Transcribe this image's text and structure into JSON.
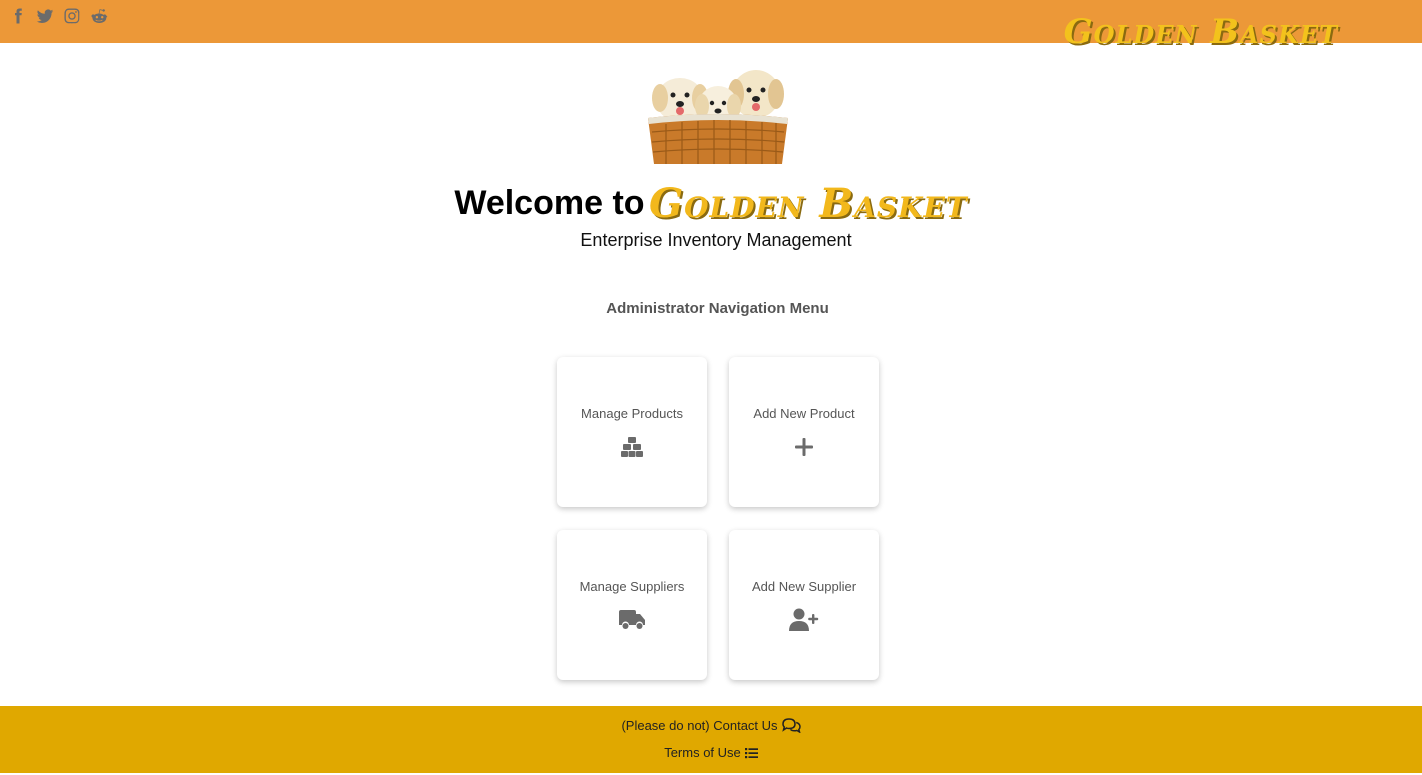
{
  "header": {
    "brand": "Golden Basket",
    "social": [
      {
        "icon": "facebook-icon"
      },
      {
        "icon": "twitter-icon"
      },
      {
        "icon": "instagram-icon"
      },
      {
        "icon": "reddit-icon"
      }
    ],
    "colors": {
      "bar": "#ec9838",
      "brand": "#f3c21c"
    }
  },
  "hero": {
    "welcome_text": "Welcome to",
    "brand": "Golden Basket",
    "subtitle": "Enterprise Inventory Management"
  },
  "menu": {
    "title": "Administrator Navigation Menu",
    "cards": [
      {
        "label": "Manage Products",
        "icon": "boxes-icon"
      },
      {
        "label": "Add New Product",
        "icon": "plus-icon"
      },
      {
        "label": "Manage Suppliers",
        "icon": "truck-icon"
      },
      {
        "label": "Add New Supplier",
        "icon": "user-plus-icon"
      }
    ]
  },
  "footer": {
    "contact": "(Please do not) Contact Us",
    "terms": "Terms of Use",
    "colors": {
      "bar": "#e0a800"
    }
  }
}
